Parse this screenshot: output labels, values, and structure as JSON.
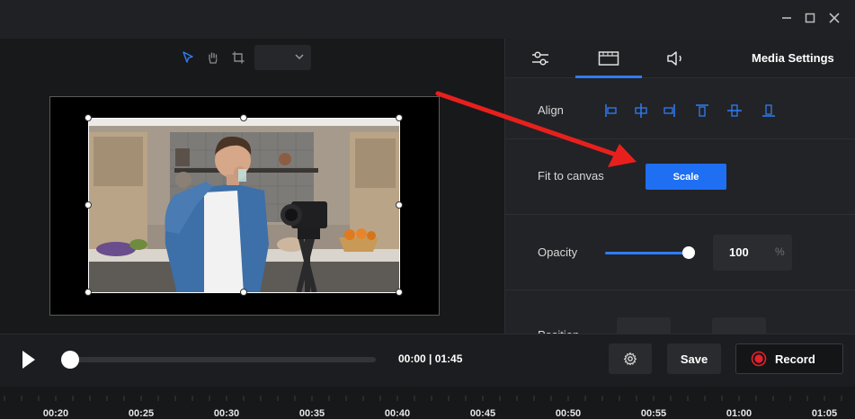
{
  "window": {
    "minimize_glyph": "–",
    "maximize_glyph": "□",
    "close_glyph": "✕"
  },
  "preview": {
    "tools": [
      "pointer-icon",
      "hand-icon",
      "crop-icon"
    ],
    "zoom_value": ""
  },
  "panel": {
    "title": "Media Settings",
    "tabs": [
      "sliders-icon",
      "film-icon",
      "speaker-icon"
    ],
    "active_tab": 1,
    "align": {
      "label": "Align"
    },
    "fit": {
      "label": "Fit to canvas",
      "button": "Scale"
    },
    "opacity": {
      "label": "Opacity",
      "value": "100",
      "unit": "%",
      "level": 1.0
    },
    "position": {
      "label": "Position"
    }
  },
  "playback": {
    "time": "00:00 | 01:45",
    "save_label": "Save",
    "record_label": "Record"
  },
  "timeline": {
    "ticks": [
      "00:20",
      "00:25",
      "00:30",
      "00:35",
      "00:40",
      "00:45",
      "00:50",
      "00:55",
      "01:00",
      "01:05"
    ]
  },
  "colors": {
    "accent": "#2f7df6",
    "record": "#e8202a",
    "arrow": "#e8201d"
  }
}
